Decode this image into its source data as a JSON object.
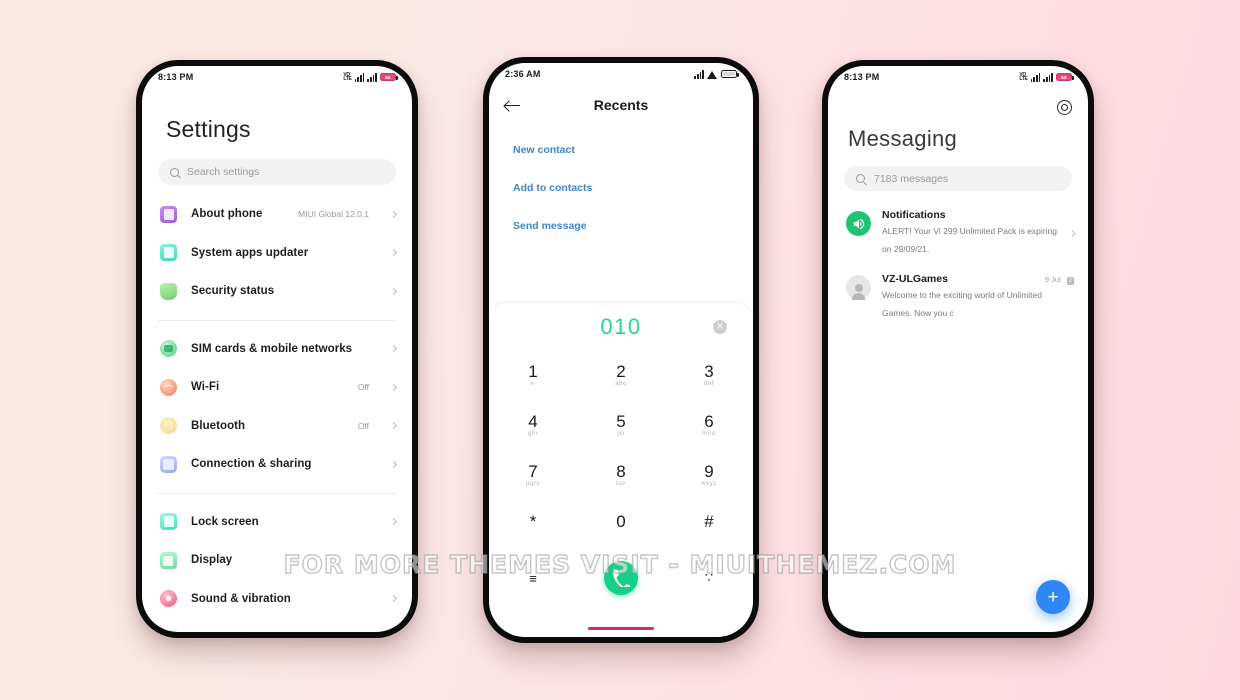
{
  "watermark": "FOR MORE THEMES VISIT - MIUITHEMEZ.COM",
  "colors": {
    "accent_green": "#15d188",
    "accent_blue": "#2f86f6",
    "link_blue": "#3f86c9",
    "dial_number": "#29d492",
    "home_indicator": "#cf2b72"
  },
  "settings_phone": {
    "status": {
      "time": "8:13 PM",
      "hd_label": "VO\nLTE",
      "battery": "66"
    },
    "title": "Settings",
    "search": {
      "placeholder": "Search settings",
      "icon": "search-icon"
    },
    "groups": [
      {
        "items": [
          {
            "label": "About phone",
            "value": "MIUI Global 12.0.1",
            "icon": "phone-purple-icon"
          },
          {
            "label": "System apps updater",
            "value": "",
            "icon": "phone-teal-icon"
          },
          {
            "label": "Security status",
            "value": "",
            "icon": "shield-icon"
          }
        ]
      },
      {
        "items": [
          {
            "label": "SIM cards & mobile networks",
            "value": "",
            "icon": "sim-card-icon"
          },
          {
            "label": "Wi-Fi",
            "value": "Off",
            "icon": "wifi-icon"
          },
          {
            "label": "Bluetooth",
            "value": "Off",
            "icon": "bluetooth-icon"
          },
          {
            "label": "Connection & sharing",
            "value": "",
            "icon": "connection-icon"
          }
        ]
      },
      {
        "items": [
          {
            "label": "Lock screen",
            "value": "",
            "icon": "lock-screen-icon"
          },
          {
            "label": "Display",
            "value": "",
            "icon": "display-icon"
          },
          {
            "label": "Sound & vibration",
            "value": "",
            "icon": "sound-icon"
          }
        ]
      }
    ]
  },
  "dialer_phone": {
    "status": {
      "time": "2:36 AM"
    },
    "nav": {
      "back_icon": "back-arrow-icon",
      "title": "Recents"
    },
    "actions": [
      {
        "label": "New contact"
      },
      {
        "label": "Add to contacts"
      },
      {
        "label": "Send message"
      }
    ],
    "keypad": {
      "entered_number": "010",
      "clear_icon": "clear-circle-icon",
      "keys": [
        {
          "digit": "1",
          "letters": "∞"
        },
        {
          "digit": "2",
          "letters": "abc"
        },
        {
          "digit": "3",
          "letters": "def"
        },
        {
          "digit": "4",
          "letters": "ghi"
        },
        {
          "digit": "5",
          "letters": "jkl"
        },
        {
          "digit": "6",
          "letters": "mno"
        },
        {
          "digit": "7",
          "letters": "pqrs"
        },
        {
          "digit": "8",
          "letters": "tuv"
        },
        {
          "digit": "9",
          "letters": "wxyz"
        },
        {
          "digit": "*",
          "letters": ""
        },
        {
          "digit": "0",
          "letters": "+"
        },
        {
          "digit": "#",
          "letters": ""
        }
      ],
      "bottom_left": "≡",
      "bottom_right": "∵",
      "call_icon": "phone-call-icon"
    }
  },
  "messaging_phone": {
    "status": {
      "time": "8:13 PM",
      "battery": "66"
    },
    "settings_icon": "gear-icon",
    "title": "Messaging",
    "search": {
      "placeholder": "7183 messages",
      "icon": "search-icon"
    },
    "threads": [
      {
        "name": "Notifications",
        "snippet": "ALERT! Your Vi 299 Unlimited Pack is expiring on 29/09/21.",
        "time": "",
        "badge": "",
        "avatar": "notification-speaker-icon",
        "avatar_style": "green"
      },
      {
        "name": "VZ-ULGames",
        "snippet": "Welcome to the exciting world of Unlimited Games. Now you c",
        "time": "9 Jul",
        "badge": "2",
        "avatar": "person-icon",
        "avatar_style": "gray"
      }
    ],
    "fab": {
      "label": "+",
      "icon": "plus-icon"
    }
  }
}
